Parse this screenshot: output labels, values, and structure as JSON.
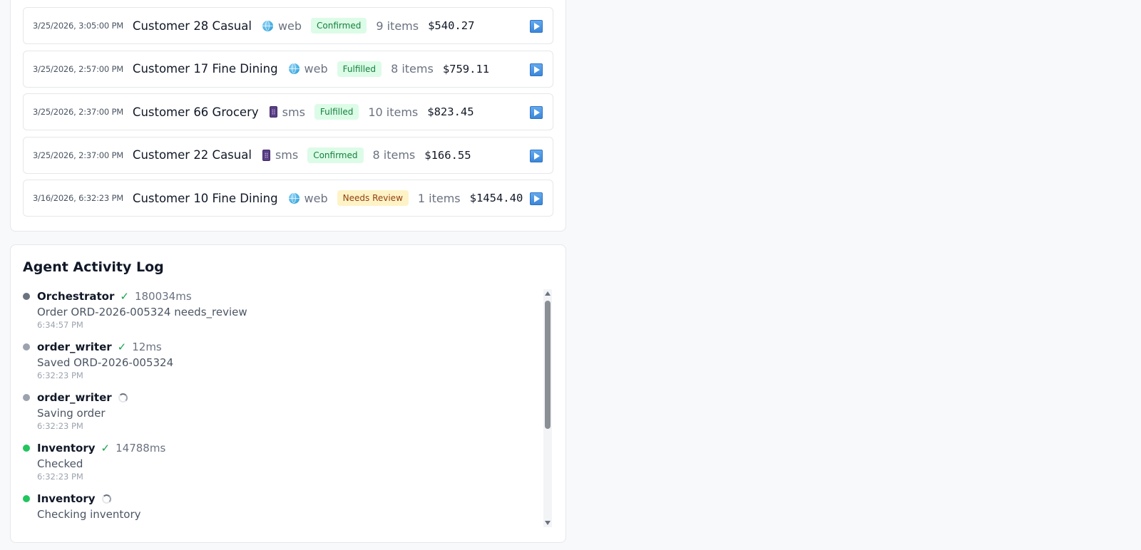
{
  "orders": [
    {
      "time": "3/25/2026, 3:05:00 PM",
      "customer": "Customer 28 Casual",
      "channel": "web",
      "channel_icon": "globe-icon",
      "status": "Confirmed",
      "status_bg": "#dcfce7",
      "status_fg": "#15803d",
      "items": "9 items",
      "total": "$540.27"
    },
    {
      "time": "3/25/2026, 2:57:00 PM",
      "customer": "Customer 17 Fine Dining",
      "channel": "web",
      "channel_icon": "globe-icon",
      "status": "Fulfilled",
      "status_bg": "#dcfce7",
      "status_fg": "#15803d",
      "items": "8 items",
      "total": "$759.11"
    },
    {
      "time": "3/25/2026, 2:37:00 PM",
      "customer": "Customer 66 Grocery",
      "channel": "sms",
      "channel_icon": "mobile-phone-icon",
      "status": "Fulfilled",
      "status_bg": "#dcfce7",
      "status_fg": "#15803d",
      "items": "10 items",
      "total": "$823.45"
    },
    {
      "time": "3/25/2026, 2:37:00 PM",
      "customer": "Customer 22 Casual",
      "channel": "sms",
      "channel_icon": "mobile-phone-icon",
      "status": "Confirmed",
      "status_bg": "#dcfce7",
      "status_fg": "#15803d",
      "items": "8 items",
      "total": "$166.55"
    },
    {
      "time": "3/16/2026, 6:32:23 PM",
      "customer": "Customer 10 Fine Dining",
      "channel": "web",
      "channel_icon": "globe-icon",
      "status": "Needs Review",
      "status_bg": "#fef3c7",
      "status_fg": "#92400e",
      "items": "1 items",
      "total": "$1454.40"
    }
  ],
  "activity": {
    "title": "Agent Activity Log",
    "entries": [
      {
        "agent": "Orchestrator",
        "dot_color": "#6b7280",
        "state": "done",
        "duration": "180034ms",
        "message": "Order ORD-2026-005324 needs_review",
        "time": "6:34:57 PM"
      },
      {
        "agent": "order_writer",
        "dot_color": "#9ca3af",
        "state": "done",
        "duration": "12ms",
        "message": "Saved ORD-2026-005324",
        "time": "6:32:23 PM"
      },
      {
        "agent": "order_writer",
        "dot_color": "#9ca3af",
        "state": "running",
        "duration": "",
        "message": "Saving order",
        "time": "6:32:23 PM"
      },
      {
        "agent": "Inventory",
        "dot_color": "#22c55e",
        "state": "done",
        "duration": "14788ms",
        "message": "Checked",
        "time": "6:32:23 PM"
      },
      {
        "agent": "Inventory",
        "dot_color": "#22c55e",
        "state": "running",
        "duration": "",
        "message": "Checking inventory",
        "time": ""
      }
    ]
  },
  "icons": {
    "check": "✓"
  }
}
